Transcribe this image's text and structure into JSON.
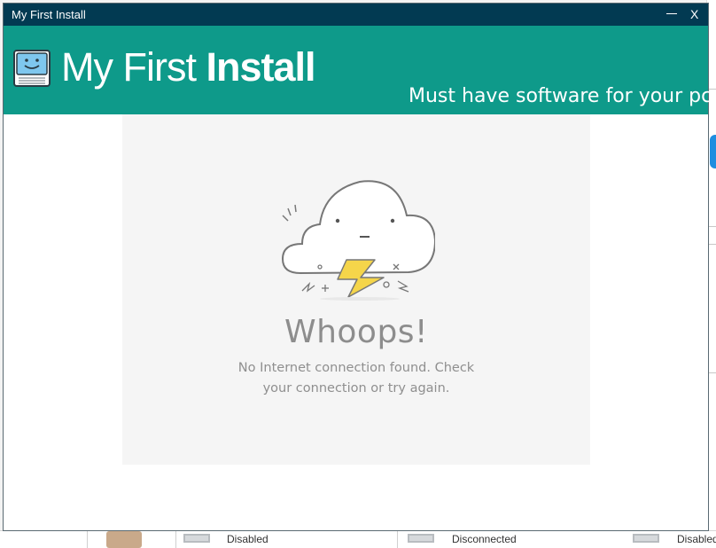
{
  "window": {
    "title": "My First Install",
    "close_label": "X"
  },
  "banner": {
    "brand_light": "My First ",
    "brand_bold": "Install",
    "tagline": "Must have software for your pc"
  },
  "error": {
    "heading": "Whoops!",
    "line1": "No Internet connection found. Check",
    "line2": "your connection or try again."
  },
  "background": {
    "items": [
      {
        "label": "Disabled"
      },
      {
        "label": "Disconnected"
      },
      {
        "label": "Disabled"
      }
    ]
  },
  "colors": {
    "titlebar": "#023a52",
    "banner": "#0e9a8a",
    "panel": "#f5f5f5",
    "text_muted": "#8d8d8d",
    "lightning": "#f5d54a"
  }
}
